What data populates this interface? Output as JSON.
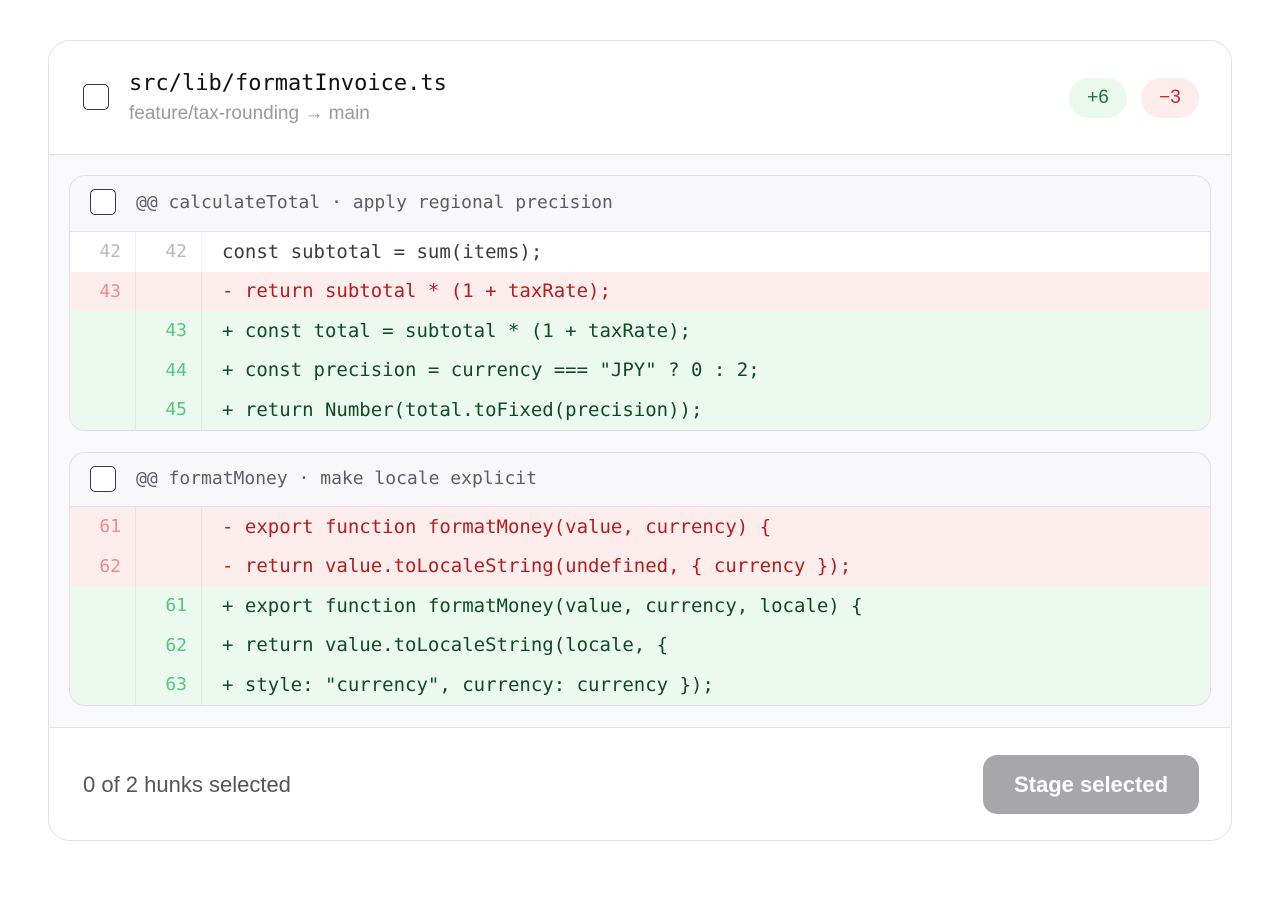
{
  "file": {
    "path": "src/lib/formatInvoice.ts",
    "branch": "feature/tax-rounding → main",
    "additions": "+6",
    "deletions": "−3"
  },
  "hunks": [
    {
      "title": "@@ calculateTotal · apply regional precision",
      "lines": [
        {
          "type": "ctx",
          "old": "42",
          "new": "42",
          "code": "const subtotal = sum(items);"
        },
        {
          "type": "del",
          "old": "43",
          "new": "",
          "code": "- return subtotal * (1 + taxRate);"
        },
        {
          "type": "add",
          "old": "",
          "new": "43",
          "code": "+ const total = subtotal * (1 + taxRate);"
        },
        {
          "type": "add",
          "old": "",
          "new": "44",
          "code": "+ const precision = currency === \"JPY\" ? 0 : 2;"
        },
        {
          "type": "add",
          "old": "",
          "new": "45",
          "code": "+ return Number(total.toFixed(precision));"
        }
      ]
    },
    {
      "title": "@@ formatMoney · make locale explicit",
      "lines": [
        {
          "type": "del",
          "old": "61",
          "new": "",
          "code": "- export function formatMoney(value, currency) {"
        },
        {
          "type": "del",
          "old": "62",
          "new": "",
          "code": "- return value.toLocaleString(undefined, { currency });"
        },
        {
          "type": "add",
          "old": "",
          "new": "61",
          "code": "+ export function formatMoney(value, currency, locale) {"
        },
        {
          "type": "add",
          "old": "",
          "new": "62",
          "code": "+ return value.toLocaleString(locale, {"
        },
        {
          "type": "add",
          "old": "",
          "new": "63",
          "code": "+ style: \"currency\", currency: currency });"
        }
      ]
    }
  ],
  "footer": {
    "selection_count": "0 of 2 hunks selected",
    "stage_label": "Stage selected"
  },
  "colors": {
    "addition": "#1d7a3a",
    "deletion": "#c42b2b",
    "button_disabled": "#a7a7a9"
  }
}
